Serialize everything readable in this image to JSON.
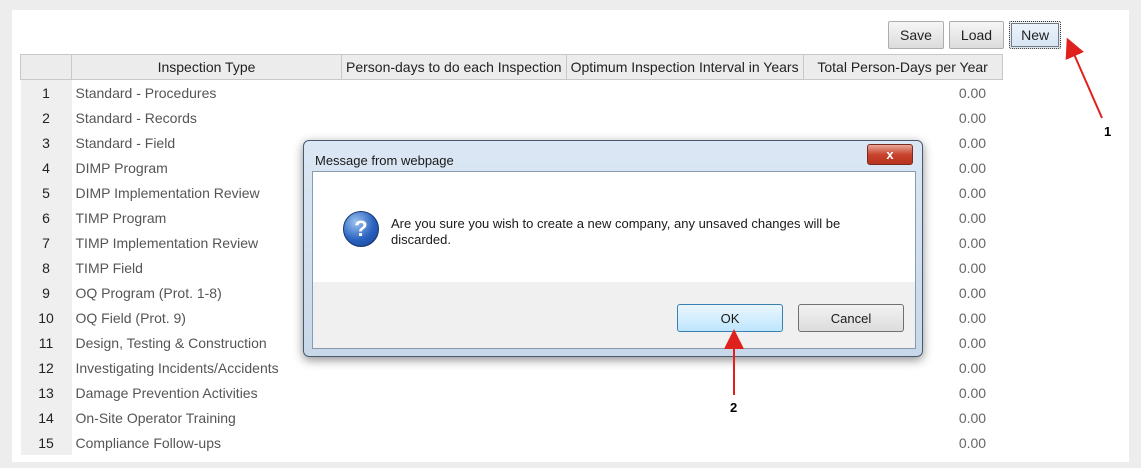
{
  "toolbar": {
    "save_label": "Save",
    "load_label": "Load",
    "new_label": "New"
  },
  "table": {
    "columns": [
      "Inspection Type",
      "Person-days to do each Inspection",
      "Optimum Inspection Interval in Years",
      "Total Person-Days per Year"
    ],
    "rows": [
      {
        "num": "1",
        "type": "Standard - Procedures",
        "total": "0.00"
      },
      {
        "num": "2",
        "type": "Standard - Records",
        "total": "0.00"
      },
      {
        "num": "3",
        "type": "Standard - Field",
        "total": "0.00"
      },
      {
        "num": "4",
        "type": "DIMP Program",
        "total": "0.00"
      },
      {
        "num": "5",
        "type": "DIMP Implementation Review",
        "total": "0.00"
      },
      {
        "num": "6",
        "type": "TIMP Program",
        "total": "0.00"
      },
      {
        "num": "7",
        "type": "TIMP Implementation Review",
        "total": "0.00"
      },
      {
        "num": "8",
        "type": "TIMP Field",
        "total": "0.00"
      },
      {
        "num": "9",
        "type": "OQ Program (Prot. 1-8)",
        "total": "0.00"
      },
      {
        "num": "10",
        "type": "OQ Field (Prot. 9)",
        "total": "0.00"
      },
      {
        "num": "11",
        "type": "Design, Testing & Construction",
        "total": "0.00"
      },
      {
        "num": "12",
        "type": "Investigating Incidents/Accidents",
        "total": "0.00"
      },
      {
        "num": "13",
        "type": "Damage Prevention Activities",
        "total": "0.00"
      },
      {
        "num": "14",
        "type": "On-Site Operator Training",
        "total": "0.00"
      },
      {
        "num": "15",
        "type": "Compliance Follow-ups",
        "total": "0.00"
      }
    ]
  },
  "dialog": {
    "title": "Message from webpage",
    "close_label": "x",
    "icon": "question-icon",
    "message": "Are you sure you wish to create a new company, any unsaved changes will be discarded.",
    "ok_label": "OK",
    "cancel_label": "Cancel"
  },
  "annotations": {
    "label_1": "1",
    "label_2": "2",
    "arrow_color": "#e0201c"
  }
}
